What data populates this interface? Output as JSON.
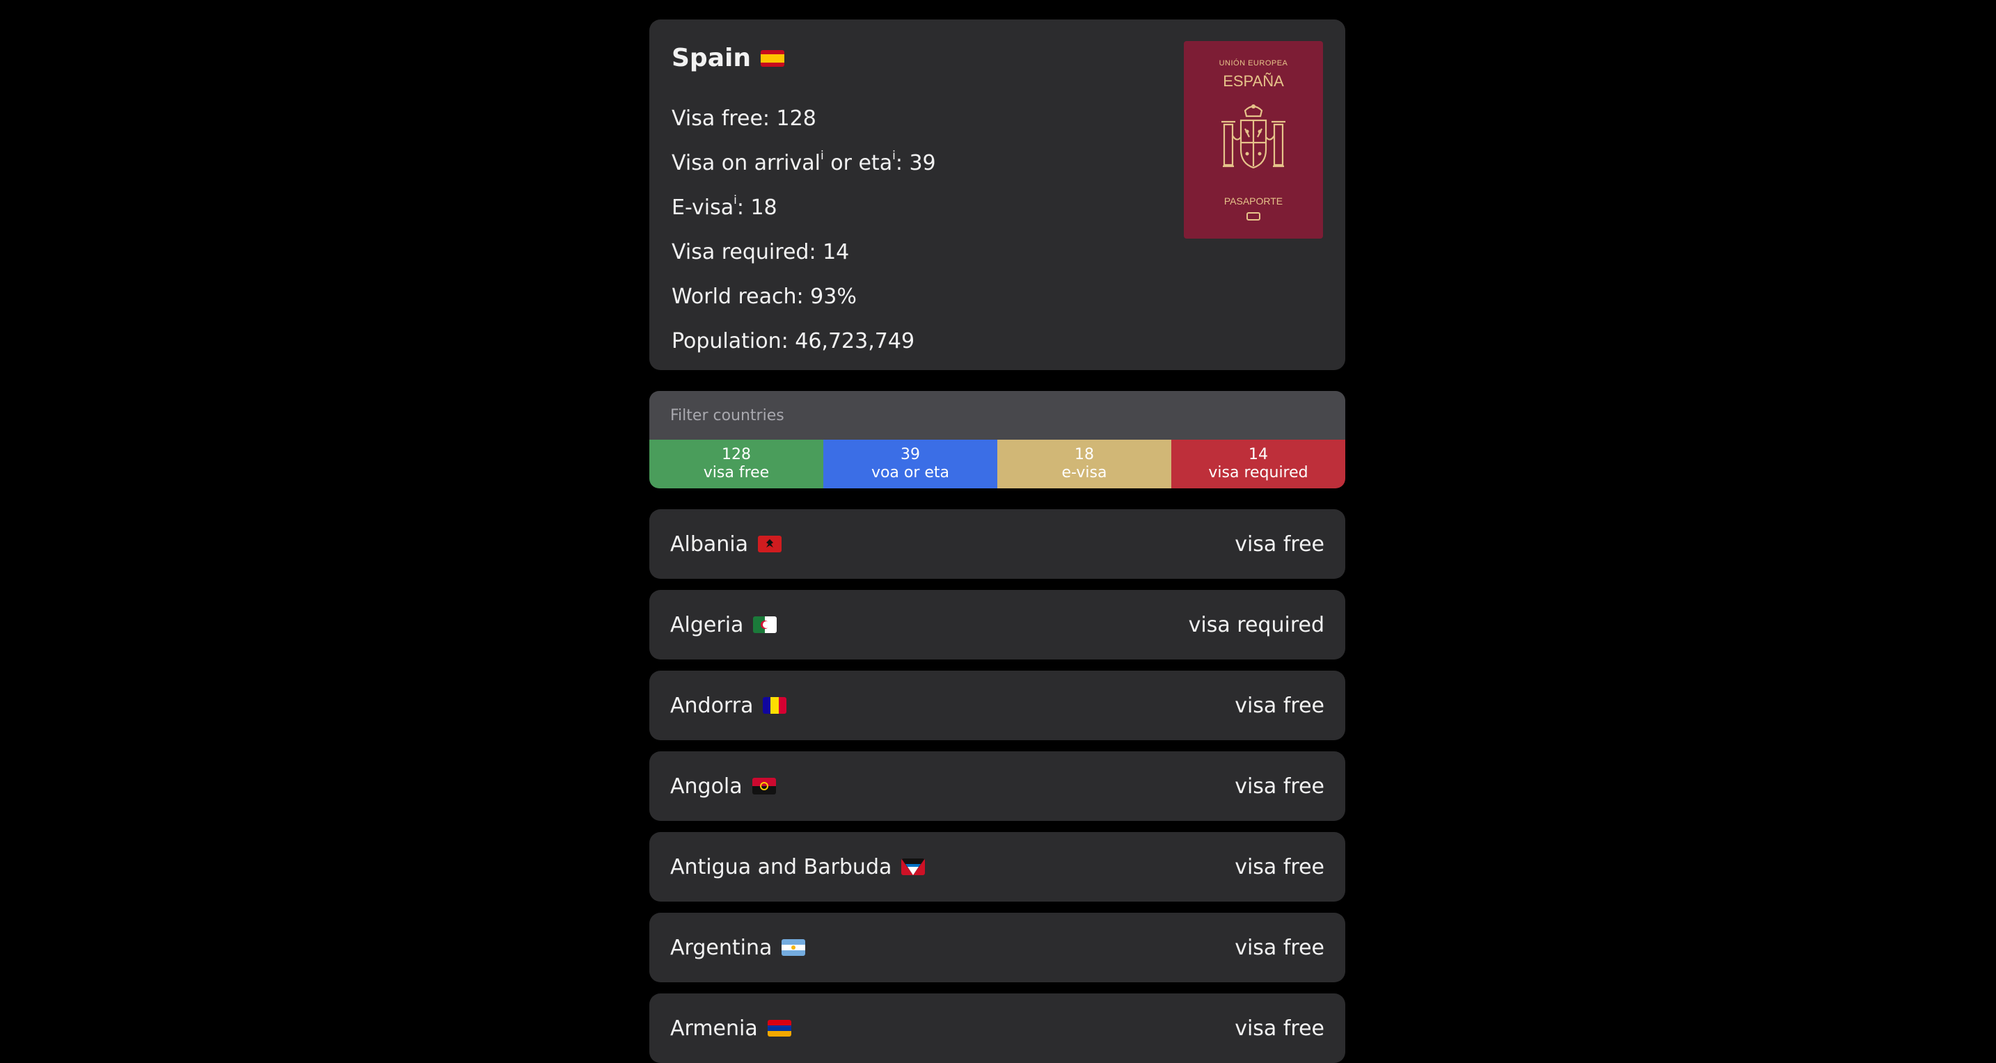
{
  "country": {
    "name": "Spain",
    "flag_icon": "spain-flag-icon",
    "visa_free": "Visa free: 128",
    "voa_prefix": "Visa on arrival",
    "voa_mid": " or eta",
    "voa_suffix": ": 39",
    "info_marker": "i",
    "evisa_prefix": "E-visa",
    "evisa_suffix": ": 18",
    "visa_required": "Visa required: 14",
    "world_reach": "World reach: 93%",
    "population": "Population: 46,723,749"
  },
  "passport": {
    "line1": "UNIÓN EUROPEA",
    "line2": "ESPAÑA",
    "line3": "PASAPORTE",
    "color": "#7d1d35",
    "text_color": "#e6c38a"
  },
  "filter": {
    "placeholder": "Filter countries"
  },
  "summary": [
    {
      "count": "128",
      "label": "visa free",
      "color": "#4a9d5b"
    },
    {
      "count": "39",
      "label": "voa or eta",
      "color": "#3b6ee6"
    },
    {
      "count": "18",
      "label": "e-visa",
      "color": "#d1b776"
    },
    {
      "count": "14",
      "label": "visa required",
      "color": "#be2f3a"
    }
  ],
  "rows": [
    {
      "name": "Albania",
      "status": "visa free",
      "flag_icon": "albania-flag-icon"
    },
    {
      "name": "Algeria",
      "status": "visa required",
      "flag_icon": "algeria-flag-icon"
    },
    {
      "name": "Andorra",
      "status": "visa free",
      "flag_icon": "andorra-flag-icon"
    },
    {
      "name": "Angola",
      "status": "visa free",
      "flag_icon": "angola-flag-icon"
    },
    {
      "name": "Antigua and Barbuda",
      "status": "visa free",
      "flag_icon": "antigua-barbuda-flag-icon"
    },
    {
      "name": "Argentina",
      "status": "visa free",
      "flag_icon": "argentina-flag-icon"
    },
    {
      "name": "Armenia",
      "status": "visa free",
      "flag_icon": "armenia-flag-icon"
    }
  ]
}
